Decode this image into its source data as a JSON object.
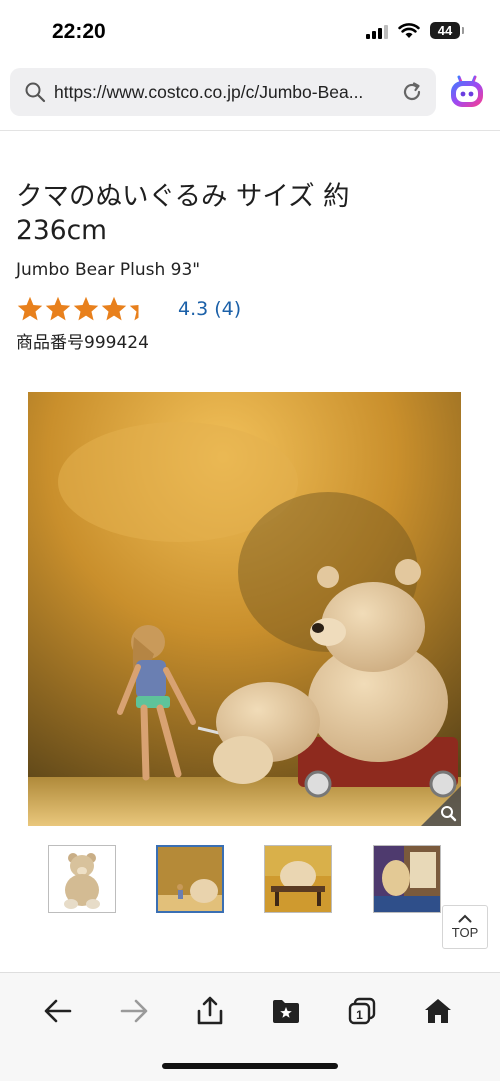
{
  "status_bar": {
    "time": "22:20",
    "battery": "44"
  },
  "browser": {
    "url": "https://www.costco.co.jp/c/Jumbo-Bea...",
    "toolbar": [
      "back-icon",
      "forward-icon",
      "share-icon",
      "bookmarks-icon",
      "tabs-icon",
      "home-icon"
    ],
    "tab_count": "1"
  },
  "product": {
    "title": "クマのぬいぐるみ サイズ 約 236cm",
    "subtitle": "Jumbo Bear Plush 93\"",
    "rating_value": 4.3,
    "rating_text": "4.3 (4)",
    "item_number": "商品番号999424"
  },
  "gallery": {
    "thumbnail_count": 4,
    "active_thumbnail": 2
  },
  "scroll_top": {
    "label": "TOP"
  },
  "colors": {
    "star": "#e8801c",
    "link": "#1b60a8",
    "active_thumb": "#3a6fb3"
  }
}
